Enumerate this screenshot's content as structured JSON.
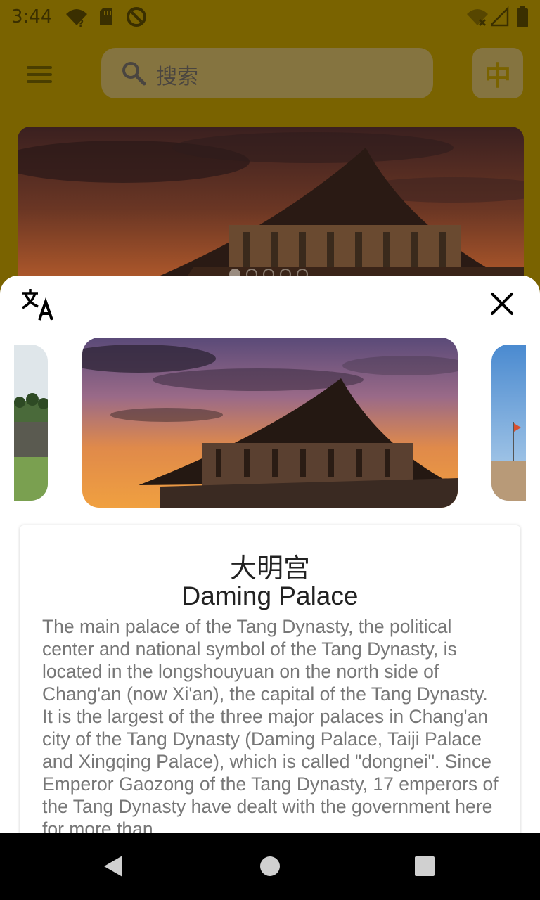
{
  "status_bar": {
    "time": "3:44",
    "icons": [
      "wifi-question-icon",
      "sd-card-icon",
      "sync-icon",
      "wifi-off-icon",
      "signal-icon",
      "battery-icon"
    ]
  },
  "app_bar": {
    "search_placeholder": "搜索",
    "language_button": "中"
  },
  "banner": {
    "image": "daming-palace-photo",
    "dots_total": 5,
    "active_dot": 1
  },
  "detail_sheet": {
    "carousel": [
      "park-photo",
      "daming-palace-photo",
      "city-wall-photo"
    ],
    "title_cn": "大明宫",
    "title_en": "Daming Palace",
    "description": "The main palace of the Tang Dynasty, the political center and national symbol of the Tang Dynasty, is located in the longshouyuan on the north side of Chang'an (now Xi'an), the capital of the Tang Dynasty. It is the largest of the three major palaces in Chang'an city of the Tang Dynasty (Daming Palace, Taiji Palace and Xingqing Palace), which is called \"dongnei\". Since Emperor Gaozong of the Tang Dynasty, 17 emperors of the Tang Dynasty have dealt with the government here for more than"
  },
  "colors": {
    "app_bar": "#7a6300",
    "accent": "#f5c400",
    "sheet": "#ffffff"
  }
}
